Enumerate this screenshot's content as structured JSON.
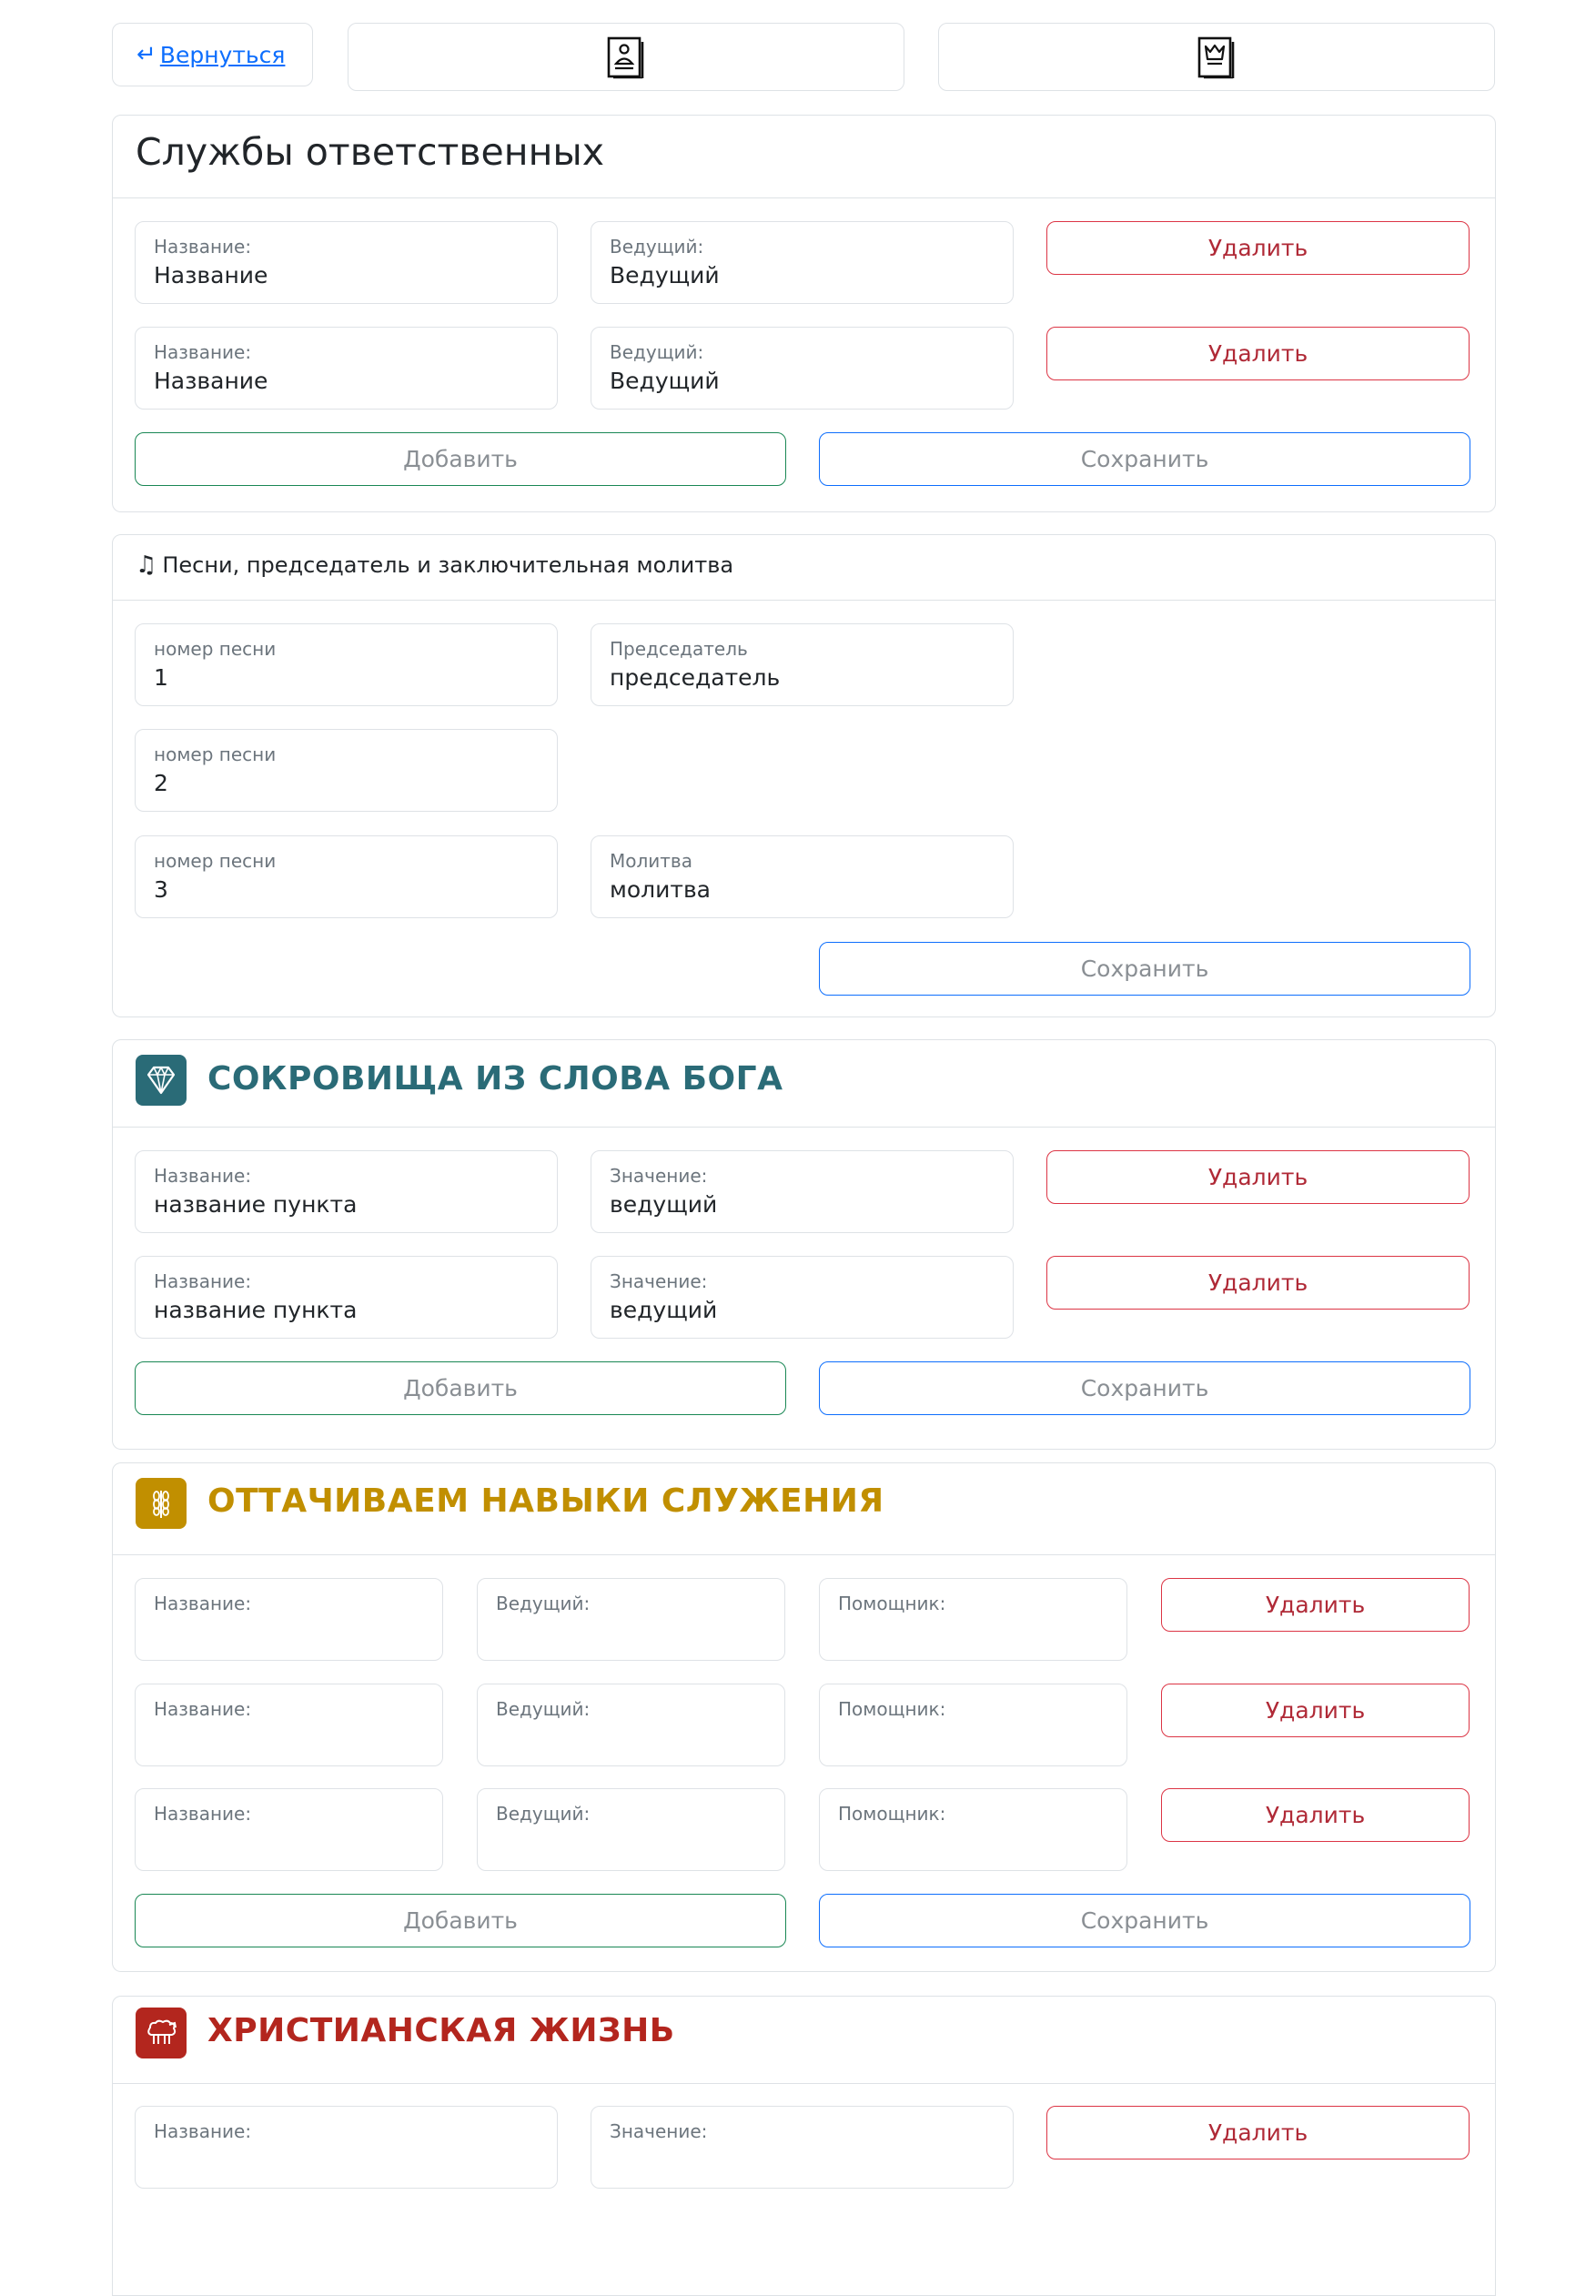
{
  "nav": {
    "back_label": "Вернуться",
    "icon1": "document-person-icon",
    "icon2": "document-crown-icon"
  },
  "services": {
    "title": "Службы ответственных",
    "rows": [
      {
        "name_label": "Название:",
        "name_value": "Название",
        "host_label": "Ведущий:",
        "host_value": "Ведущий",
        "delete_label": "Удалить"
      },
      {
        "name_label": "Название:",
        "name_value": "Название",
        "host_label": "Ведущий:",
        "host_value": "Ведущий",
        "delete_label": "Удалить"
      }
    ],
    "add_label": "Добавить",
    "save_label": "Сохранить"
  },
  "songs": {
    "title": "Песни, председатель и заключительная молитва",
    "icon": "music-note-icon",
    "song1_label": "номер песни",
    "song1_value": "1",
    "chairman_label": "Председатель",
    "chairman_value": "председатель",
    "song2_label": "номер песни",
    "song2_value": "2",
    "song3_label": "номер песни",
    "song3_value": "3",
    "prayer_label": "Молитва",
    "prayer_value": "молитва",
    "save_label": "Сохранить"
  },
  "treasures": {
    "title": "СОКРОВИЩА ИЗ СЛОВА БОГА",
    "icon": "diamond-icon",
    "color": "#2a6b77",
    "rows": [
      {
        "name_label": "Название:",
        "name_value": "название пункта",
        "value_label": "Значение:",
        "value_value": "ведущий",
        "delete_label": "Удалить"
      },
      {
        "name_label": "Название:",
        "name_value": "название пункта",
        "value_label": "Значение:",
        "value_value": "ведущий",
        "delete_label": "Удалить"
      }
    ],
    "add_label": "Добавить",
    "save_label": "Сохранить"
  },
  "ministry": {
    "title": "ОТТАЧИВАЕМ НАВЫКИ СЛУЖЕНИЯ",
    "icon": "wheat-icon",
    "color": "#c18f00",
    "rows": [
      {
        "name_label": "Название:",
        "host_label": "Ведущий:",
        "assistant_label": "Помощник:",
        "delete_label": "Удалить"
      },
      {
        "name_label": "Название:",
        "host_label": "Ведущий:",
        "assistant_label": "Помощник:",
        "delete_label": "Удалить"
      },
      {
        "name_label": "Название:",
        "host_label": "Ведущий:",
        "assistant_label": "Помощник:",
        "delete_label": "Удалить"
      }
    ],
    "add_label": "Добавить",
    "save_label": "Сохранить"
  },
  "christian": {
    "title": "ХРИСТИАНСКАЯ ЖИЗНЬ",
    "icon": "sheep-icon",
    "color": "#b3261e",
    "rows": [
      {
        "name_label": "Название:",
        "value_label": "Значение:",
        "delete_label": "Удалить"
      }
    ]
  }
}
